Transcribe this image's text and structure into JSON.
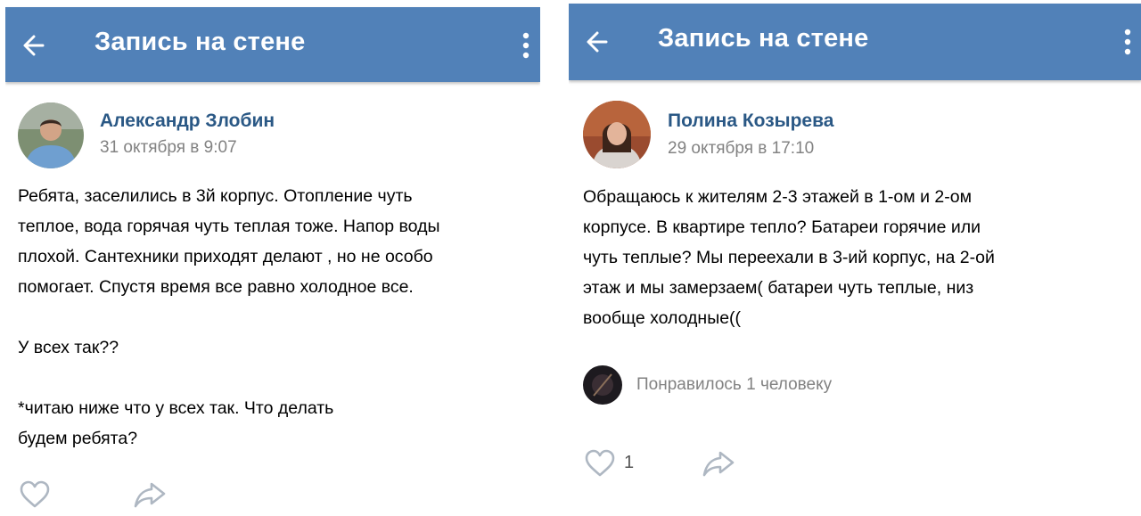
{
  "screens": [
    {
      "appbar": {
        "title": "Запись на стене",
        "back_icon": "arrow-left-icon",
        "menu_icon": "more-vertical-icon"
      },
      "post": {
        "author": "Александр Злобин",
        "date": "31 октября в 9:07",
        "text": "Ребята, заселились в 3й корпус. Отопление чуть\nтеплое, вода горячая чуть теплая тоже. Напор воды\nплохой. Сантехники приходят делают , но не особо\nпомогает. Спустя время все равно холодное все.\n\nУ всех так??\n\n*читаю ниже что у всех так. Что делать\nбудем ребята?"
      },
      "actions": {
        "like_icon": "heart-outline-icon",
        "share_icon": "share-arrow-icon"
      }
    },
    {
      "appbar": {
        "title": "Запись на стене",
        "back_icon": "arrow-left-icon",
        "menu_icon": "more-vertical-icon"
      },
      "post": {
        "author": "Полина Козырева",
        "date": "29 октября в 17:10",
        "text": "Обращаюсь к жителям 2-3 этажей в 1-ом и 2-ом\nкорпусе. В квартире тепло? Батареи горячие или\nчуть теплые? Мы переехали в 3-ий корпус, на 2-ой\nэтаж и мы замерзаем( батареи чуть теплые, низ\nвообще холодные(("
      },
      "likes_summary": "Понравилось 1 человеку",
      "actions": {
        "like_icon": "heart-outline-icon",
        "like_count": "1",
        "share_icon": "share-arrow-icon"
      }
    }
  ],
  "colors": {
    "header_bg": "#5181b8",
    "author_name": "#2a5885",
    "secondary_text": "#828282",
    "icon_gray": "#aeb7c2"
  }
}
